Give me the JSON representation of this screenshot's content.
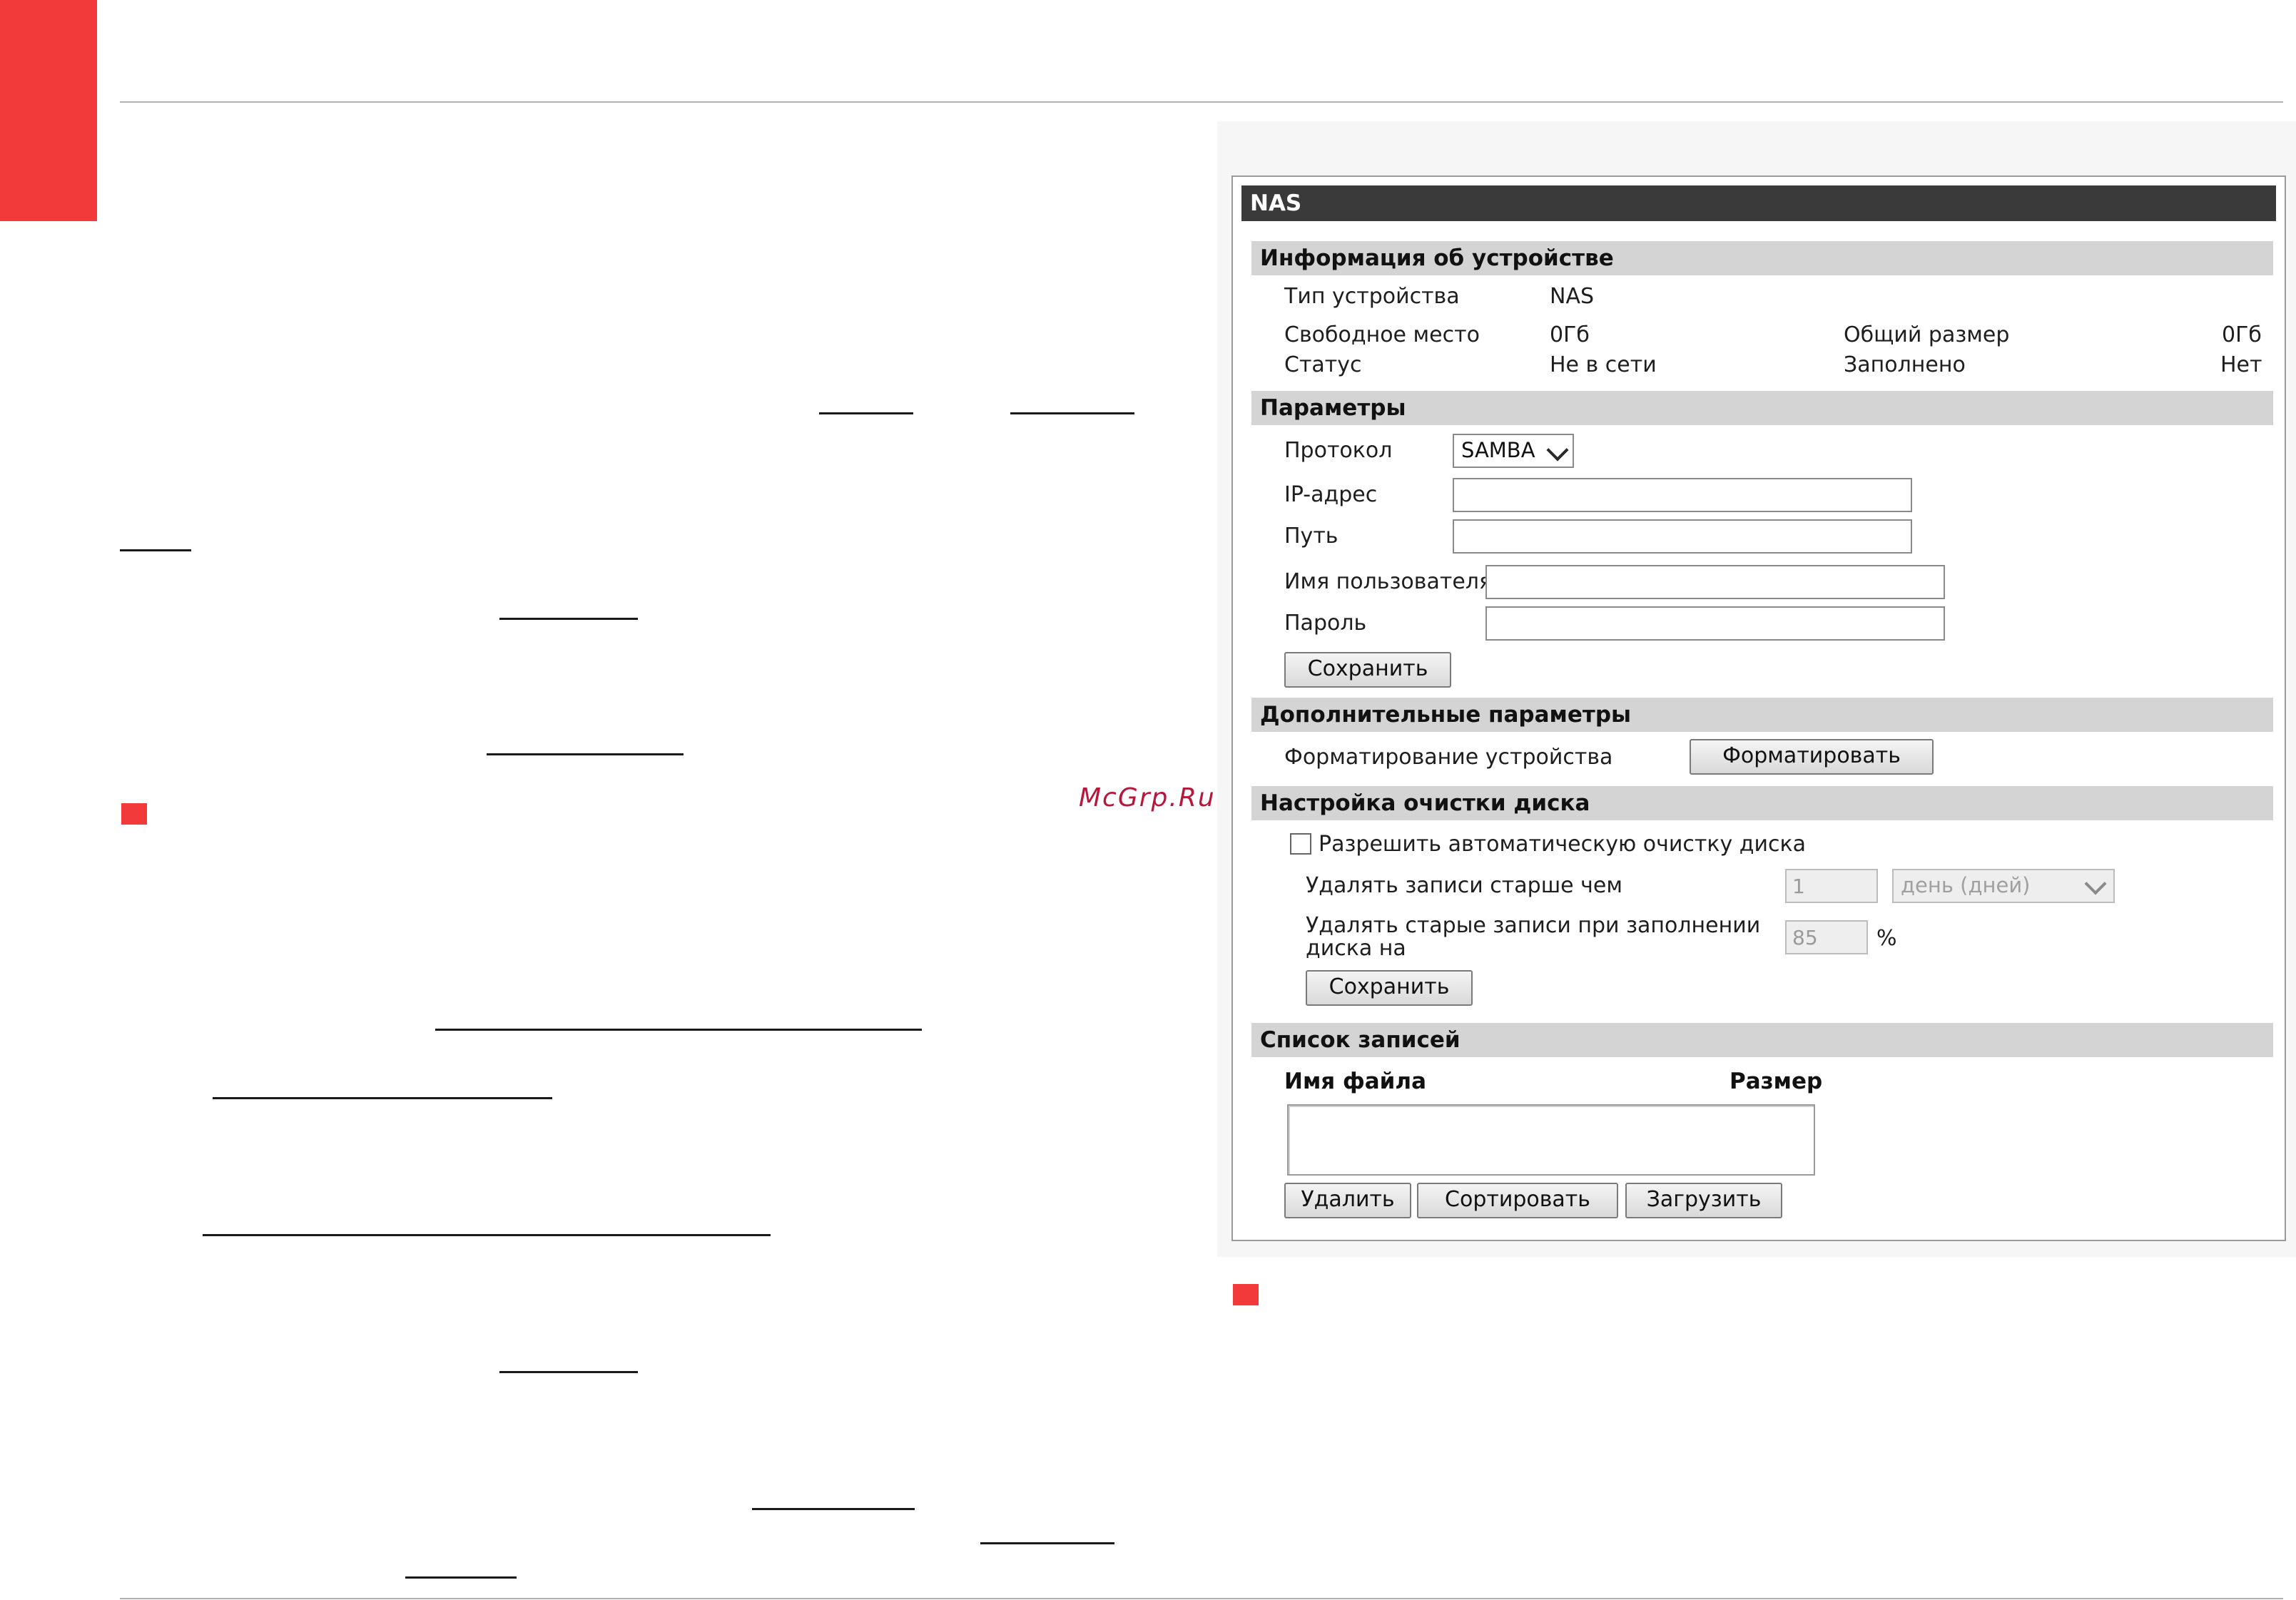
{
  "watermark": "McGrp.Ru",
  "nas_panel": {
    "title": "NAS",
    "device_info": {
      "heading": "Информация об устройстве",
      "type_label": "Тип устройства",
      "type_value": "NAS",
      "free_label": "Свободное место",
      "free_value": "0Гб",
      "total_label": "Общий размер",
      "total_value": "0Гб",
      "status_label": "Статус",
      "status_value": "Не в сети",
      "full_label": "Заполнено",
      "full_value": "Нет"
    },
    "params": {
      "heading": "Параметры",
      "protocol_label": "Протокол",
      "protocol_value": "SAMBA",
      "ip_label": "IP-адрес",
      "ip_value": "",
      "path_label": "Путь",
      "path_value": "",
      "user_label": "Имя пользователя",
      "user_value": "",
      "password_label": "Пароль",
      "password_value": "",
      "save_label": "Сохранить"
    },
    "advanced": {
      "heading": "Дополнительные параметры",
      "format_label": "Форматирование устройства",
      "format_button": "Форматировать"
    },
    "cleanup": {
      "heading": "Настройка очистки диска",
      "auto_label": "Разрешить автоматическую очистку диска",
      "auto_checked": false,
      "older_label": "Удалять записи старше чем",
      "older_value": "1",
      "older_unit": "день (дней)",
      "full_label_line1": "Удалять старые записи при заполнении",
      "full_label_line2": "диска на",
      "full_value": "85",
      "percent": "%",
      "save_label": "Сохранить"
    },
    "records": {
      "heading": "Список записей",
      "col_name": "Имя файла",
      "col_size": "Размер",
      "delete_button": "Удалить",
      "sort_button": "Сортировать",
      "download_button": "Загрузить"
    }
  }
}
